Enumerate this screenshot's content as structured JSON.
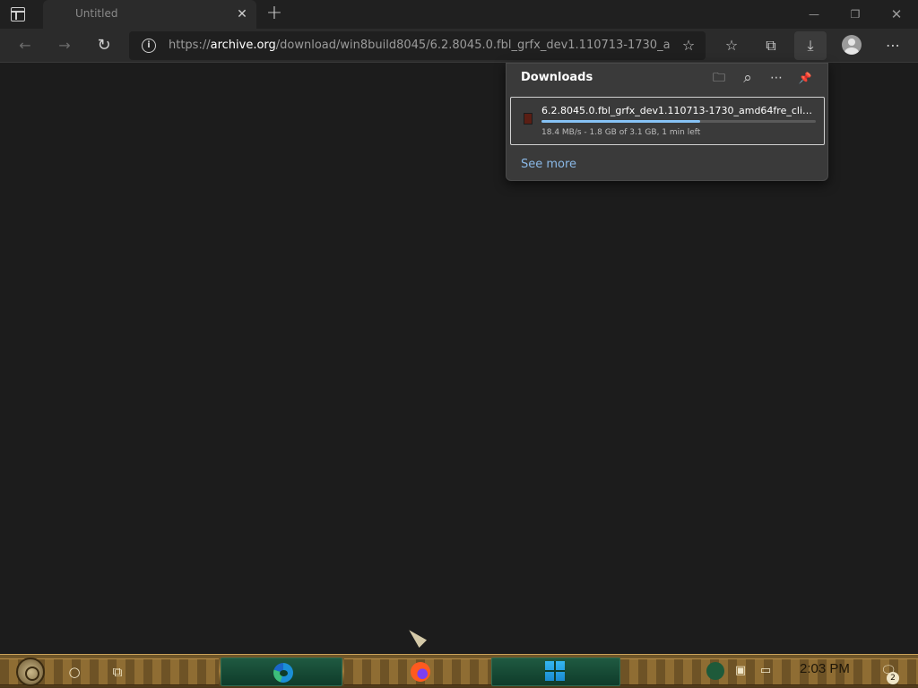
{
  "browser": {
    "tab": {
      "title": "Untitled",
      "close_glyph": "✕"
    },
    "new_tab_glyph": "+",
    "window_controls": {
      "minimize": "—",
      "restore": "❐",
      "close": "✕"
    },
    "toolbar": {
      "back_glyph": "←",
      "forward_glyph": "→",
      "refresh_glyph": "↻",
      "info_glyph": "i",
      "url_prefix": "https://",
      "url_host": "archive.org",
      "url_path": "/download/win8build8045/6.2.8045.0.fbl_grfx_dev1.110713-1730_amd...",
      "add_favorite_glyph": "☆",
      "favorites_glyph": "☆",
      "collections_glyph": "⧉",
      "downloads_glyph": "⤓",
      "more_glyph": "⋯"
    }
  },
  "downloads_panel": {
    "title": "Downloads",
    "open_folder_glyph": "🗀",
    "search_glyph": "⌕",
    "more_glyph": "⋯",
    "pin_glyph": "📌",
    "item": {
      "file_name": "6.2.8045.0.fbl_grfx_dev1.110713-1730_amd64fre_client-...",
      "status": "18.4 MB/s - 1.8 GB of 3.1 GB, 1 min left",
      "progress_fraction": 0.58
    },
    "see_more": "See more"
  },
  "taskbar": {
    "search_glyph": "○",
    "task_view_glyph": "⧉",
    "clock": "2:03 PM",
    "notification_glyph": "🗨",
    "notification_count": "2",
    "tray": {
      "meet_glyph": "▣",
      "network_glyph": "▭"
    }
  },
  "colors": {
    "page_background": "#1c1c1c",
    "progress_fill": "#86c2f5",
    "link": "#8ab8e6"
  }
}
